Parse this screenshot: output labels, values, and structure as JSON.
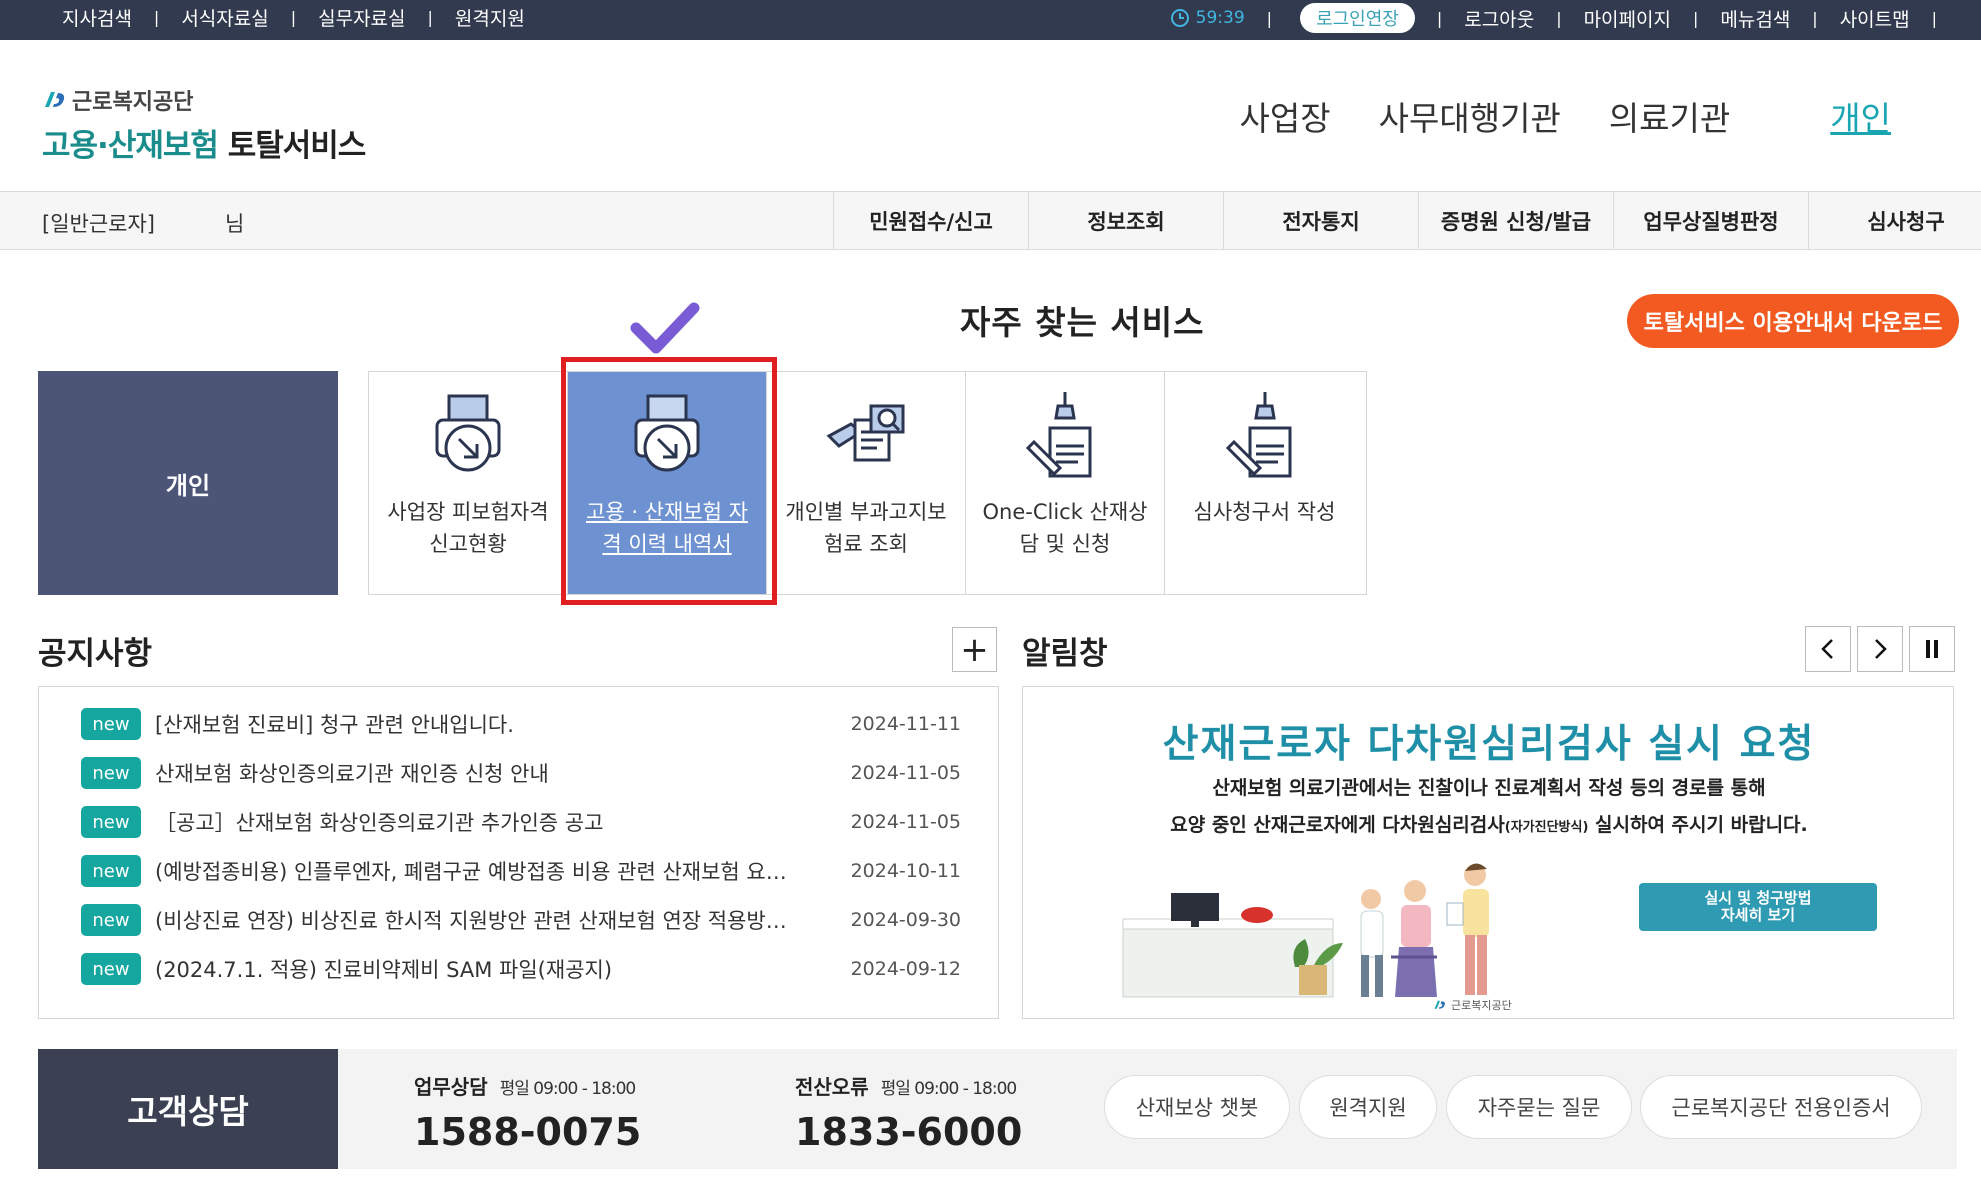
{
  "topbar": {
    "links": [
      "지사검색",
      "서식자료실",
      "실무자료실",
      "원격지원"
    ],
    "timer": "59:39",
    "extend_label": "로그인연장",
    "right_links": [
      "로그아웃",
      "마이페이지",
      "메뉴검색",
      "사이트맵"
    ]
  },
  "header": {
    "logo_org": "근로복지공단",
    "logo_service_a": "고용·산재보험",
    "logo_service_b": "토탈서비스",
    "nav": [
      "사업장",
      "사무대행기관",
      "의료기관",
      "개인"
    ]
  },
  "subnav": {
    "user_type": "[일반근로자]",
    "user_suffix": "님",
    "tabs": [
      "민원접수/신고",
      "정보조회",
      "전자통지",
      "증명원 신청/발급",
      "업무상질병판정",
      "심사청구"
    ]
  },
  "frequent": {
    "title": "자주 찾는 서비스",
    "guide_button": "토탈서비스 이용안내서 다운로드",
    "category": "개인",
    "services": [
      "사업장 피보험자격 신고현황",
      "고용 · 산재보험 자격 이력 내역서",
      "개인별 부과고지보험료 조회",
      "One-Click 산재상담 및 신청",
      "심사청구서 작성"
    ],
    "selected_index": 1
  },
  "notices": {
    "title": "공지사항",
    "more_label": "+",
    "badge": "new",
    "items": [
      {
        "text": "[산재보험 진료비] 청구 관련 안내입니다.",
        "date": "2024-11-11"
      },
      {
        "text": "산재보험 화상인증의료기관 재인증 신청 안내",
        "date": "2024-11-05"
      },
      {
        "text": "［공고］산재보험 화상인증의료기관 추가인증 공고",
        "date": "2024-11-05"
      },
      {
        "text": "(예방접종비용) 인플루엔자, 폐렴구균 예방접종 비용 관련 산재보험 요양급여 처리 안내",
        "date": "2024-10-11"
      },
      {
        "text": "(비상진료 연장) 비상진료 한시적 지원방안 관련 산재보험 연장 적용방법 안내",
        "date": "2024-09-30"
      },
      {
        "text": "(2024.7.1. 적용) 진료비약제비 SAM 파일(재공지)",
        "date": "2024-09-12"
      }
    ]
  },
  "alerts": {
    "title": "알림창",
    "headline": "산재근로자 다차원심리검사 실시 요청",
    "line1": "산재보험 의료기관에서는 진찰이나 진료계획서 작성 등의 경로를 통해",
    "line2a": "요양 중인 산재근로자에게 다차원심리검사",
    "line2b": "(자가진단방식)",
    "line2c": " 실시하여 주시기 바랍니다.",
    "button_line1": "실시 및 청구방법",
    "button_line2": "자세히 보기",
    "footer_org": "근로복지공단"
  },
  "customer": {
    "title": "고객상담",
    "work_label": "업무상담",
    "work_hours": "평일 09:00 - 18:00",
    "work_phone": "1588-0075",
    "error_label": "전산오류",
    "error_hours": "평일 09:00 - 18:00",
    "error_phone": "1833-6000",
    "pills": [
      "산재보상 챗봇",
      "원격지원",
      "자주묻는 질문",
      "근로복지공단 전용인증서"
    ]
  },
  "colors": {
    "topbar": "#323a4f",
    "accent": "#1aa5b3",
    "selected_service": "#6e92d1",
    "highlight": "#e02020",
    "guide_button": "#f25a21",
    "badge": "#16a6a0"
  }
}
